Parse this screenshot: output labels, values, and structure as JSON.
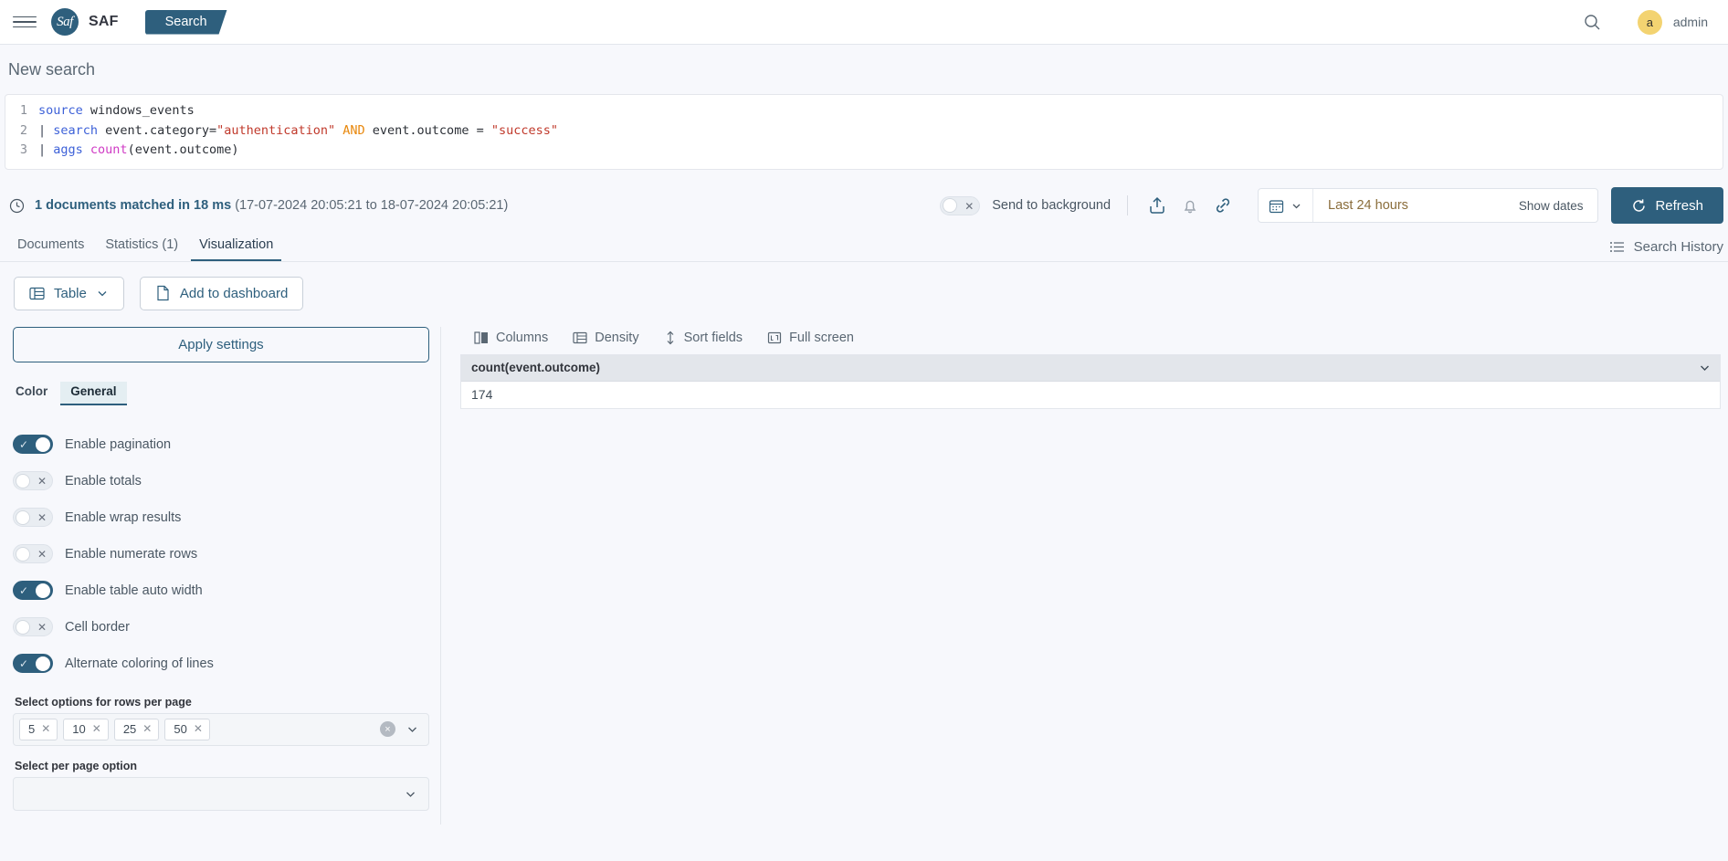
{
  "topnav": {
    "menu_icon": "hamburger-icon",
    "logo_text": "Saf",
    "brand": "SAF",
    "active_tab": "Search",
    "search_icon": "search-icon",
    "avatar_initial": "a",
    "username": "admin"
  },
  "page": {
    "title": "New search"
  },
  "query": {
    "lines": [
      {
        "num": "1",
        "tokens": [
          {
            "t": "source",
            "c": "tok-cmd"
          },
          {
            "t": " windows_events",
            "c": "tok-plain"
          }
        ]
      },
      {
        "num": "2",
        "tokens": [
          {
            "t": "| ",
            "c": "tok-pipe"
          },
          {
            "t": "search",
            "c": "tok-cmd"
          },
          {
            "t": " event.category=",
            "c": "tok-field"
          },
          {
            "t": "\"authentication\"",
            "c": "tok-str"
          },
          {
            "t": " AND",
            "c": "tok-and"
          },
          {
            "t": " event.outcome = ",
            "c": "tok-field"
          },
          {
            "t": "\"success\"",
            "c": "tok-str"
          }
        ]
      },
      {
        "num": "3",
        "tokens": [
          {
            "t": "| ",
            "c": "tok-pipe"
          },
          {
            "t": "aggs",
            "c": "tok-cmd"
          },
          {
            "t": " ",
            "c": "tok-plain"
          },
          {
            "t": "count",
            "c": "tok-fn"
          },
          {
            "t": "(event.outcome)",
            "c": "tok-plain"
          }
        ]
      }
    ]
  },
  "status": {
    "clock_icon": "clock-icon",
    "summary": "1 documents matched in 18 ms",
    "range": "(17-07-2024 20:05:21 to 18-07-2024 20:05:21)",
    "background_toggle": {
      "label": "Send to background",
      "on": false
    },
    "icons": [
      "share-icon",
      "bell-icon",
      "link-icon"
    ],
    "datepicker": {
      "calendar_icon": "calendar-icon",
      "value": "Last 24 hours",
      "show_dates": "Show dates"
    },
    "refresh_label": "Refresh"
  },
  "tabs": {
    "items": [
      {
        "label": "Documents",
        "active": false
      },
      {
        "label": "Statistics (1)",
        "active": false
      },
      {
        "label": "Visualization",
        "active": true
      }
    ],
    "search_history": "Search History"
  },
  "viz_toolbar": {
    "type_select": "Table",
    "add_dashboard": "Add to dashboard"
  },
  "settings": {
    "apply_label": "Apply settings",
    "subtabs": [
      {
        "label": "Color",
        "active": false
      },
      {
        "label": "General",
        "active": true
      }
    ],
    "options": [
      {
        "label": "Enable pagination",
        "on": true
      },
      {
        "label": "Enable totals",
        "on": false
      },
      {
        "label": "Enable wrap results",
        "on": false
      },
      {
        "label": "Enable numerate rows",
        "on": false
      },
      {
        "label": "Enable table auto width",
        "on": true
      },
      {
        "label": "Cell border",
        "on": false
      },
      {
        "label": "Alternate coloring of lines",
        "on": true
      }
    ],
    "rows_per_page": {
      "label": "Select options for rows per page",
      "chips": [
        "5",
        "10",
        "25",
        "50"
      ],
      "clear_all": "×"
    },
    "per_page_option": {
      "label": "Select per page option",
      "value": ""
    }
  },
  "grid": {
    "toolbar": [
      {
        "label": "Columns",
        "icon": "columns-icon"
      },
      {
        "label": "Density",
        "icon": "density-icon"
      },
      {
        "label": "Sort fields",
        "icon": "sort-icon"
      },
      {
        "label": "Full screen",
        "icon": "fullscreen-icon"
      }
    ],
    "columns": [
      "count(event.outcome)"
    ],
    "rows": [
      [
        "174"
      ]
    ]
  },
  "colors": {
    "accent": "#2e5f7d",
    "avatar": "#f3d371",
    "string_token": "#c0392b",
    "keyword_token": "#3d61d8",
    "function_token": "#cf3ac4"
  }
}
